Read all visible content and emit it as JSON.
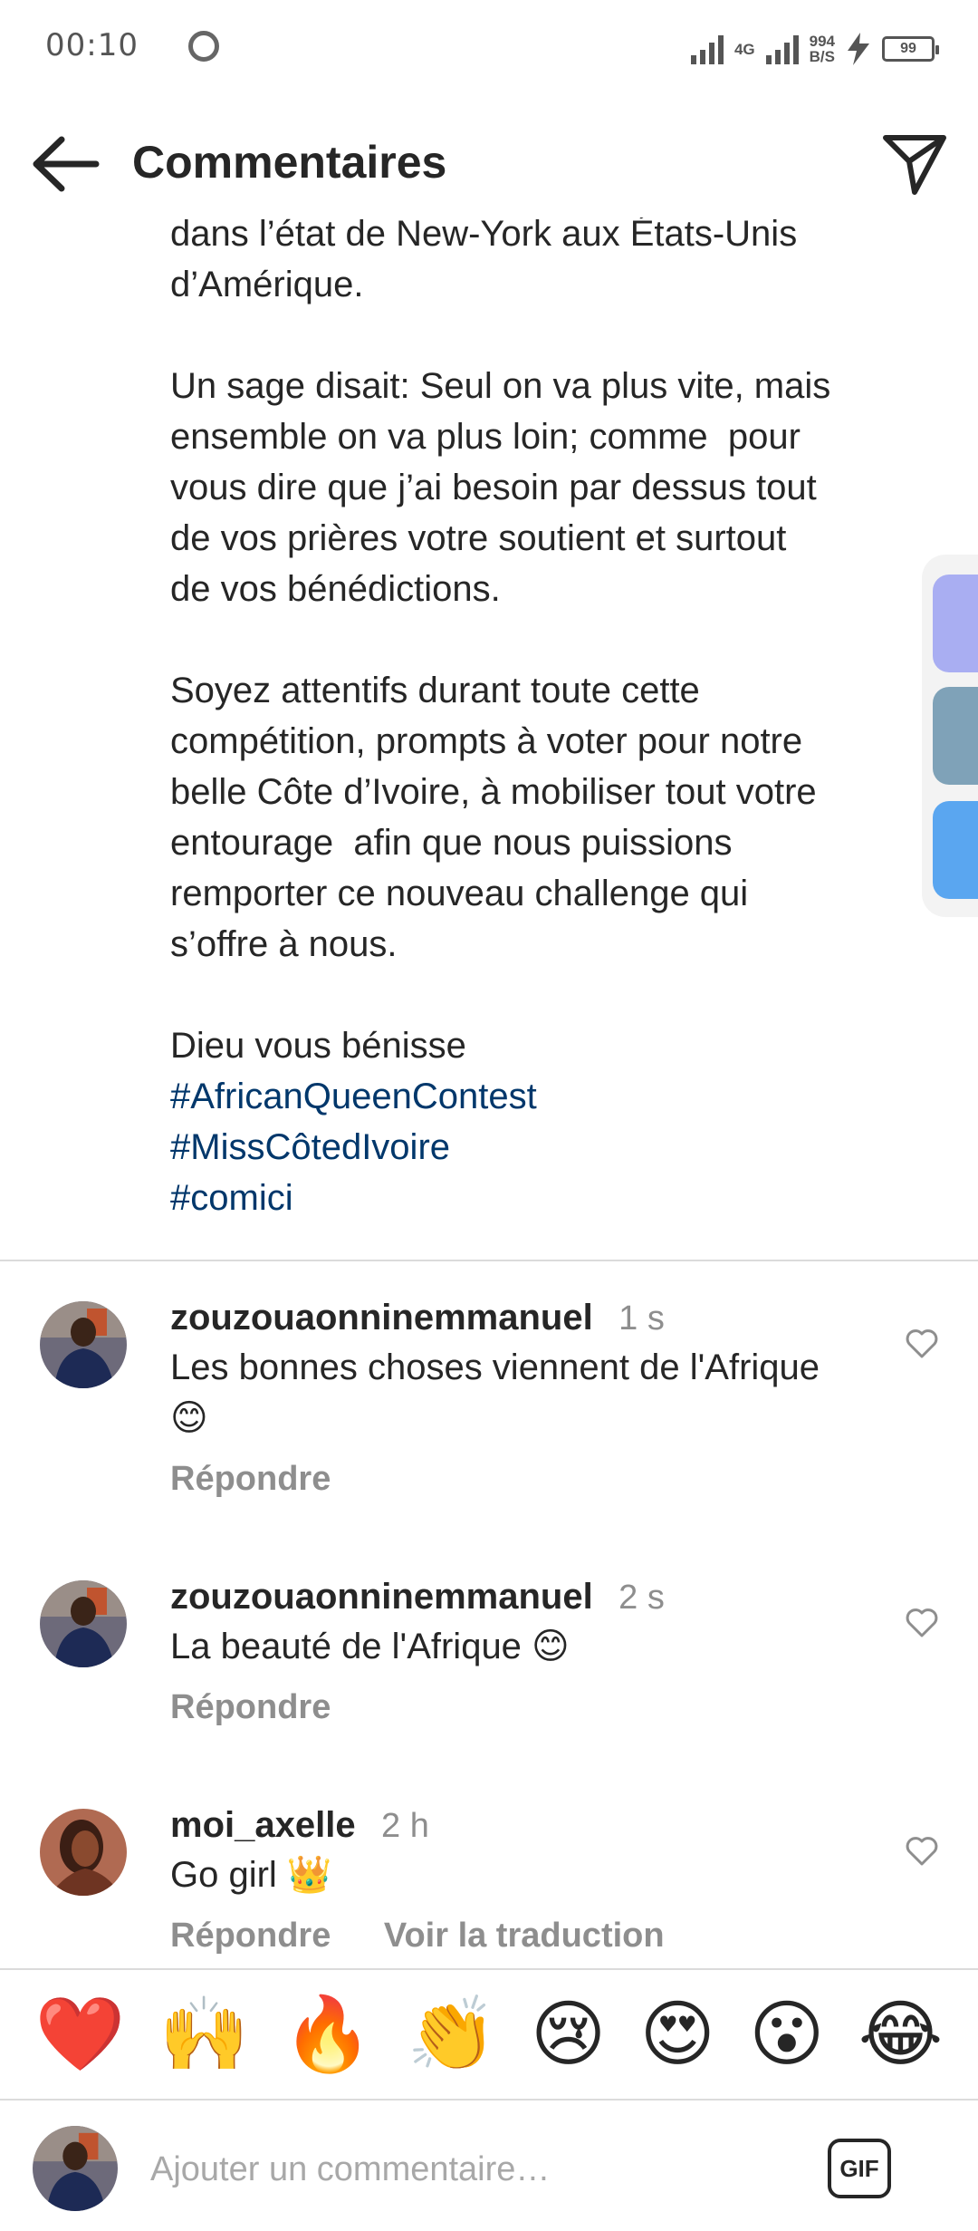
{
  "status_bar": {
    "time": "00:10",
    "network": "4G",
    "speed_value": "994",
    "speed_unit": "B/S",
    "battery": "99",
    "icons": [
      "camera-dot-icon",
      "signal-icon",
      "signal-4g-icon",
      "charging-icon",
      "battery-icon"
    ]
  },
  "header": {
    "title": "Commentaires",
    "back_icon": "arrow-left-icon",
    "share_icon": "send-icon"
  },
  "caption": {
    "lines_top": "dans l’état de New-York aux États-Unis\nd’Amérique.",
    "paragraph_2": "Un sage disait: Seul on va plus vite, mais\nensemble on va plus loin; comme  pour\nvous dire que j’ai besoin par dessus tout\nde vos prières votre soutient et surtout\nde vos bénédictions.",
    "paragraph_3": "Soyez attentifs durant toute cette\ncompétition, prompts à voter pour notre\nbelle Côte d’Ivoire, à mobiliser tout votre\nentourage  afin que nous puissions\nremporter ce nouveau challenge qui\ns’offre à nous.",
    "closing": "Dieu vous bénisse",
    "hashtags": [
      "#AfricanQueenContest",
      "#MissCôtedIvoire",
      "#comici"
    ]
  },
  "comments": [
    {
      "username": "zouzouaonninemmanuel",
      "time": "1 s",
      "text": "Les bonnes choses viennent de l'Afrique\n😊",
      "reply": "Répondre"
    },
    {
      "username": "zouzouaonninemmanuel",
      "time": "2 s",
      "text": "La beauté de l'Afrique 😊",
      "reply": "Répondre"
    },
    {
      "username": "moi_axelle",
      "time": "2 h",
      "text": "Go girl 👑",
      "reply": "Répondre",
      "translate": "Voir la traduction"
    }
  ],
  "emoji_bar": [
    "❤️",
    "🙌",
    "🔥",
    "👏",
    "😢",
    "😍",
    "😮",
    "😂"
  ],
  "input": {
    "placeholder": "Ajouter un commentaire…",
    "gif_label": "GIF"
  },
  "colors": {
    "hashtag": "#00376b",
    "secondary_text": "#8e8e8e",
    "divider": "#dbdbdb"
  }
}
